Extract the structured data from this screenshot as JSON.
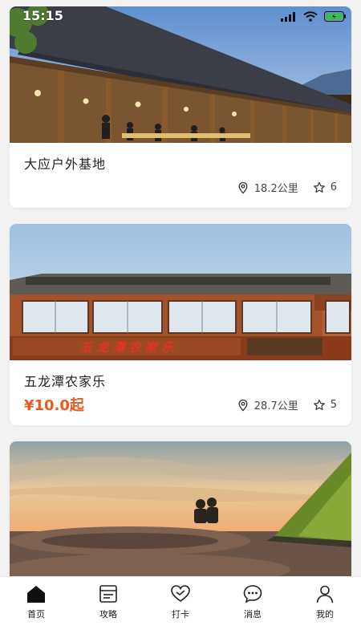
{
  "status_bar": {
    "time": "15:15"
  },
  "cards": [
    {
      "title": "大应户外基地",
      "distance": "18.2公里",
      "rating": "6"
    },
    {
      "title": "五龙潭农家乐",
      "price": "¥10.0起",
      "distance": "28.7公里",
      "rating": "5",
      "sign_text": "五 龙 潭 农 家 乐"
    },
    {
      "title": ""
    }
  ],
  "tabs": [
    {
      "label": "首页",
      "icon": "home-icon",
      "active": true
    },
    {
      "label": "攻略",
      "icon": "guide-icon"
    },
    {
      "label": "打卡",
      "icon": "heart-checkin-icon"
    },
    {
      "label": "消息",
      "icon": "message-icon"
    },
    {
      "label": "我的",
      "icon": "profile-icon"
    }
  ],
  "colors": {
    "price": "#ea5a1c",
    "background": "#f2f2f2"
  }
}
